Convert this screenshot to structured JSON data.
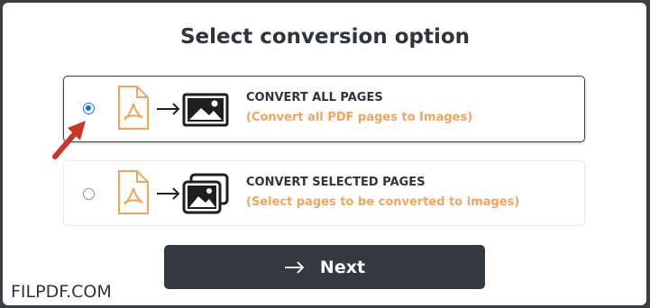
{
  "title": "Select conversion option",
  "options": [
    {
      "label": "CONVERT ALL PAGES",
      "description": "(Convert all PDF pages to Images)",
      "selected": true,
      "icon": "pdf-to-image-icon"
    },
    {
      "label": "CONVERT SELECTED PAGES",
      "description": "(Select pages to be converted to images)",
      "selected": false,
      "icon": "pdf-to-images-icon"
    }
  ],
  "next_button": {
    "label": "Next",
    "icon": "arrow-right-icon"
  },
  "watermark": "FILPDF.COM",
  "colors": {
    "accent_orange": "#f3a35a",
    "dark": "#343a3f",
    "radio_blue": "#1f6fd1",
    "pointer_red": "#c9362b"
  }
}
